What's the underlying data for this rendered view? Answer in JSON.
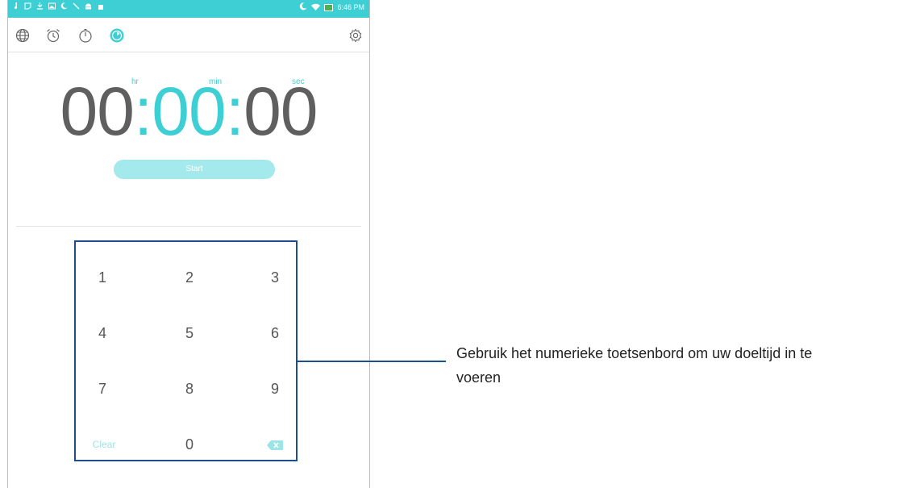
{
  "status_bar": {
    "left_icons": [
      "music-note-icon",
      "screenshot-icon",
      "download-icon",
      "image-icon",
      "moon-icon",
      "tool-icon",
      "android-icon",
      "lock-icon"
    ],
    "time": "6:46 PM"
  },
  "toolbar": {
    "tabs": [
      "world-clock",
      "alarm",
      "stopwatch",
      "timer"
    ],
    "active_tab": "timer"
  },
  "timer": {
    "label_hr": "hr",
    "label_min": "min",
    "label_sec": "sec",
    "hours": "00",
    "minutes": "00",
    "seconds": "00",
    "sep1": ":",
    "sep2": ":"
  },
  "start_label": "Start",
  "keypad": {
    "k1": "1",
    "k2": "2",
    "k3": "3",
    "k4": "4",
    "k5": "5",
    "k6": "6",
    "k7": "7",
    "k8": "8",
    "k9": "9",
    "clear": "Clear",
    "k0": "0"
  },
  "annotation": {
    "line1": "Gebruik het numerieke toetsenbord om uw doeltijd in te",
    "line2": "voeren"
  },
  "colors": {
    "accent": "#3dcfd4",
    "callout_border": "#1c4e8f"
  }
}
